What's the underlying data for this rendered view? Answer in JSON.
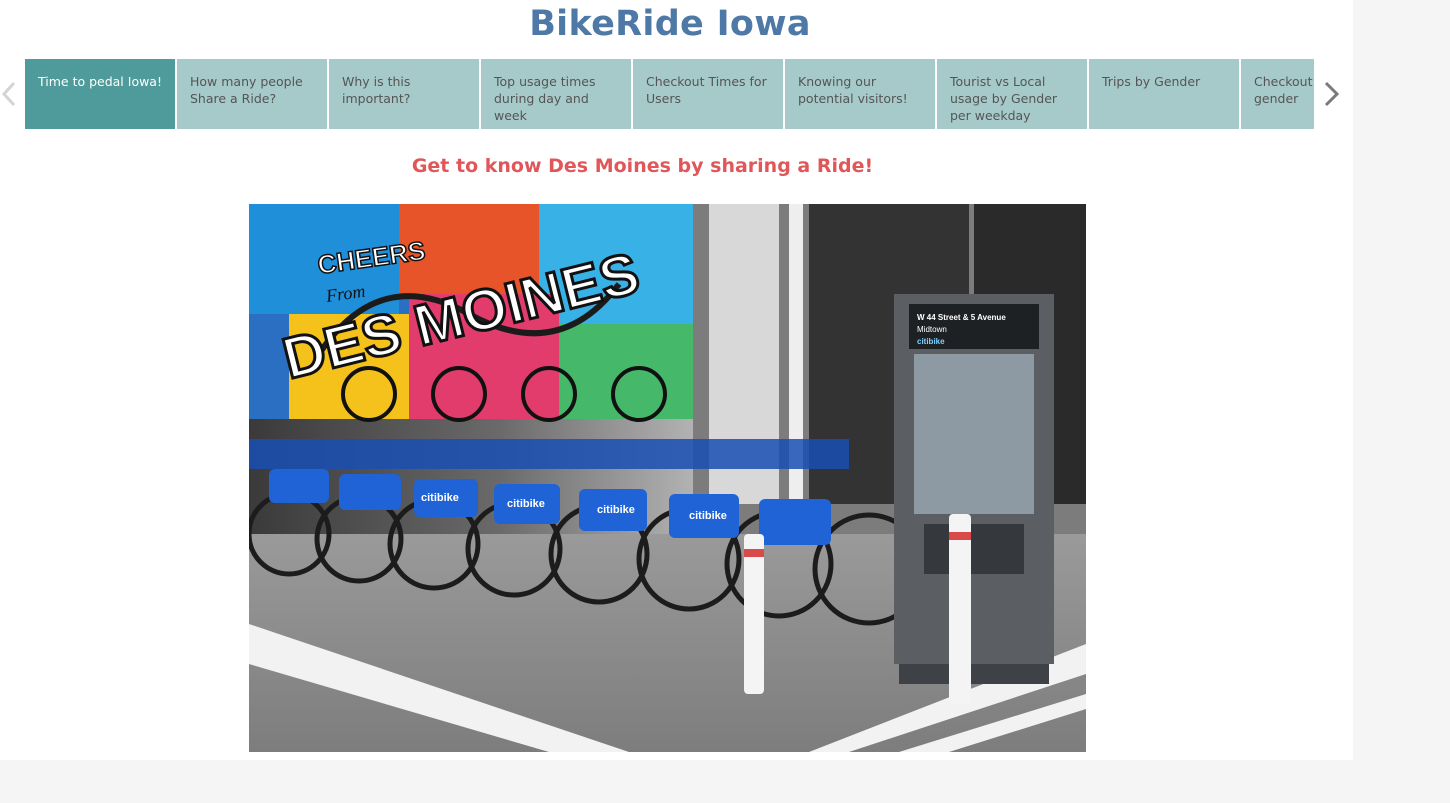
{
  "story": {
    "title": "BikeRide Iowa",
    "subtitle": "Get to know Des Moines by sharing a Ride!",
    "active_index": 0,
    "story_points": [
      {
        "label": "Time to pedal Iowa!"
      },
      {
        "label": "How many people Share a Ride?"
      },
      {
        "label": "Why is this important?"
      },
      {
        "label": "Top usage times during day and week"
      },
      {
        "label": "Checkout Times for Users"
      },
      {
        "label": "Knowing our potential visitors!"
      },
      {
        "label": "Tourist vs Local usage by Gender per weekday"
      },
      {
        "label": "Trips by Gender"
      },
      {
        "label": "Checkout times by gender"
      }
    ]
  },
  "image": {
    "mural_text": "DES MOINES",
    "mural_cheers": "CHEERS",
    "mural_from": "From",
    "bike_brand": "citibike",
    "kiosk_sign": "W 44 Street & 5 Avenue",
    "kiosk_area": "Midtown",
    "kiosk_brand": "citibike"
  },
  "colors": {
    "title": "#4e79a7",
    "subtitle": "#e15759",
    "tab_active": "#4f9a9a",
    "tab_inactive": "#a5cac9"
  }
}
